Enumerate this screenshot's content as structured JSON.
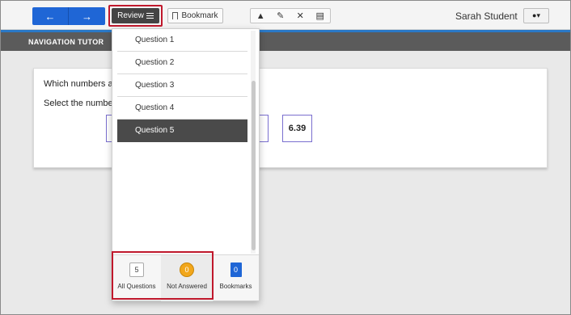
{
  "toolbar": {
    "back_icon": "left-arrow-icon",
    "forward_icon": "right-arrow-icon",
    "review_label": "Review",
    "bookmark_label": "Bookmark",
    "tools": [
      "pointer-icon",
      "highlighter-icon",
      "strikethrough-icon",
      "notepad-icon"
    ],
    "user_name": "Sarah Student",
    "user_icon": "user-icon",
    "accent_color": "#1f66d6",
    "highlight_color": "#c0182c"
  },
  "header": {
    "title": "NAVIGATION TUTOR"
  },
  "question": {
    "prompt": "Which numbers a",
    "instruction": "Select the numbe",
    "visible_answer": "6.39"
  },
  "review_panel": {
    "questions": [
      {
        "label": "Question 1",
        "active": false
      },
      {
        "label": "Question 2",
        "active": false
      },
      {
        "label": "Question 3",
        "active": false
      },
      {
        "label": "Question 4",
        "active": false
      },
      {
        "label": "Question 5",
        "active": true
      }
    ],
    "filters": {
      "all": {
        "count": "5",
        "label": "All Questions"
      },
      "not_answered": {
        "count": "0",
        "label": "Not Answered",
        "color": "#f2a71b"
      },
      "bookmarks": {
        "count": "0",
        "label": "Bookmarks"
      }
    }
  }
}
